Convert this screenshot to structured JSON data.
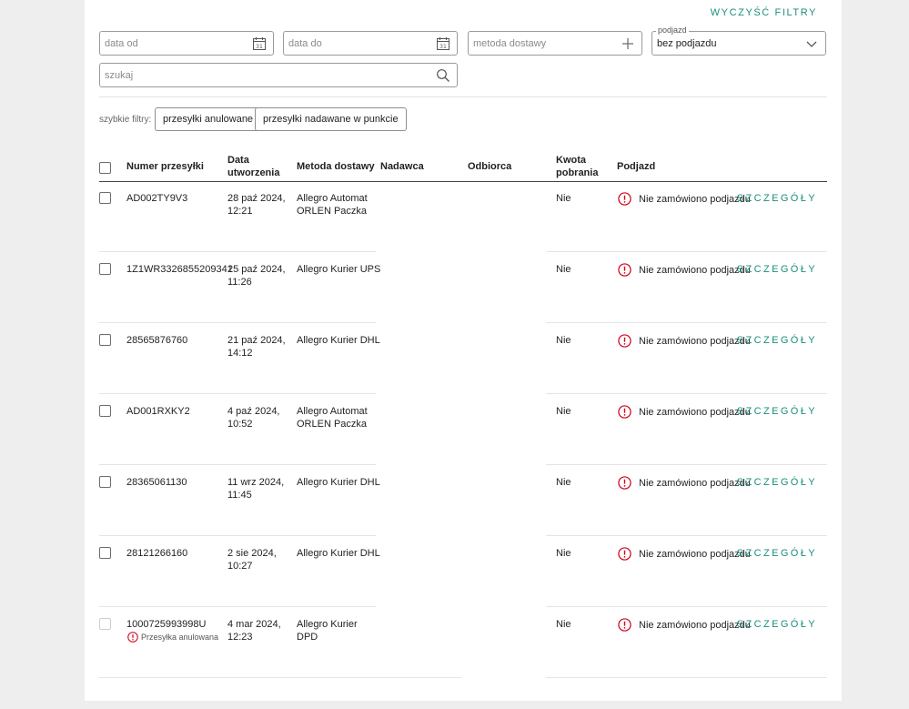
{
  "filters": {
    "clear_label": "WYCZYŚĆ FILTRY",
    "date_from_placeholder": "data od",
    "date_to_placeholder": "data do",
    "delivery_method_placeholder": "metoda dostawy",
    "pickup_label": "podjazd",
    "pickup_value": "bez podjazdu",
    "search_placeholder": "szukaj",
    "quick_filters_label": "szybkie filtry:",
    "quick_filters": [
      "przesyłki anulowane",
      "przesyłki nadawane w punkcie"
    ]
  },
  "table": {
    "headers": {
      "number": "Numer przesyłki",
      "created": "Data utworzenia",
      "method": "Metoda dostawy",
      "sender": "Nadawca",
      "recipient": "Odbiorca",
      "cod": "Kwota pobrania",
      "pickup": "Podjazd"
    },
    "details_label": "SZCZEGÓŁY",
    "rows": [
      {
        "number": "AD002TY9V3",
        "date": "28 paź 2024,",
        "time": "12:21",
        "method1": "Allegro Automat",
        "method2": "ORLEN Paczka",
        "cod": "Nie",
        "pickup": "Nie zamówiono podjazdu"
      },
      {
        "number": "1Z1WR3326855209341",
        "date": "25 paź 2024,",
        "time": "11:26",
        "method1": "Allegro Kurier UPS",
        "method2": "",
        "cod": "Nie",
        "pickup": "Nie zamówiono podjazdu"
      },
      {
        "number": "28565876760",
        "date": "21 paź 2024,",
        "time": "14:12",
        "method1": "Allegro Kurier DHL",
        "method2": "",
        "cod": "Nie",
        "pickup": "Nie zamówiono podjazdu"
      },
      {
        "number": "AD001RXKY2",
        "date": "4 paź 2024,",
        "time": "10:52",
        "method1": "Allegro Automat",
        "method2": "ORLEN Paczka",
        "cod": "Nie",
        "pickup": "Nie zamówiono podjazdu"
      },
      {
        "number": "28365061130",
        "date": "11 wrz 2024,",
        "time": "11:45",
        "method1": "Allegro Kurier DHL",
        "method2": "",
        "cod": "Nie",
        "pickup": "Nie zamówiono podjazdu"
      },
      {
        "number": "28121266160",
        "date": "2 sie 2024,",
        "time": "10:27",
        "method1": "Allegro Kurier DHL",
        "method2": "",
        "cod": "Nie",
        "pickup": "Nie zamówiono podjazdu"
      },
      {
        "number": "1000725993998U",
        "date": "4 mar 2024,",
        "time": "12:23",
        "method1": "Allegro Kurier",
        "method2": "DPD",
        "cod": "Nie",
        "pickup": "Nie zamówiono podjazdu",
        "note": "Przesyłka anulowana"
      }
    ]
  },
  "colors": {
    "accent": "#1a8e7a",
    "warning": "#d0021b"
  }
}
